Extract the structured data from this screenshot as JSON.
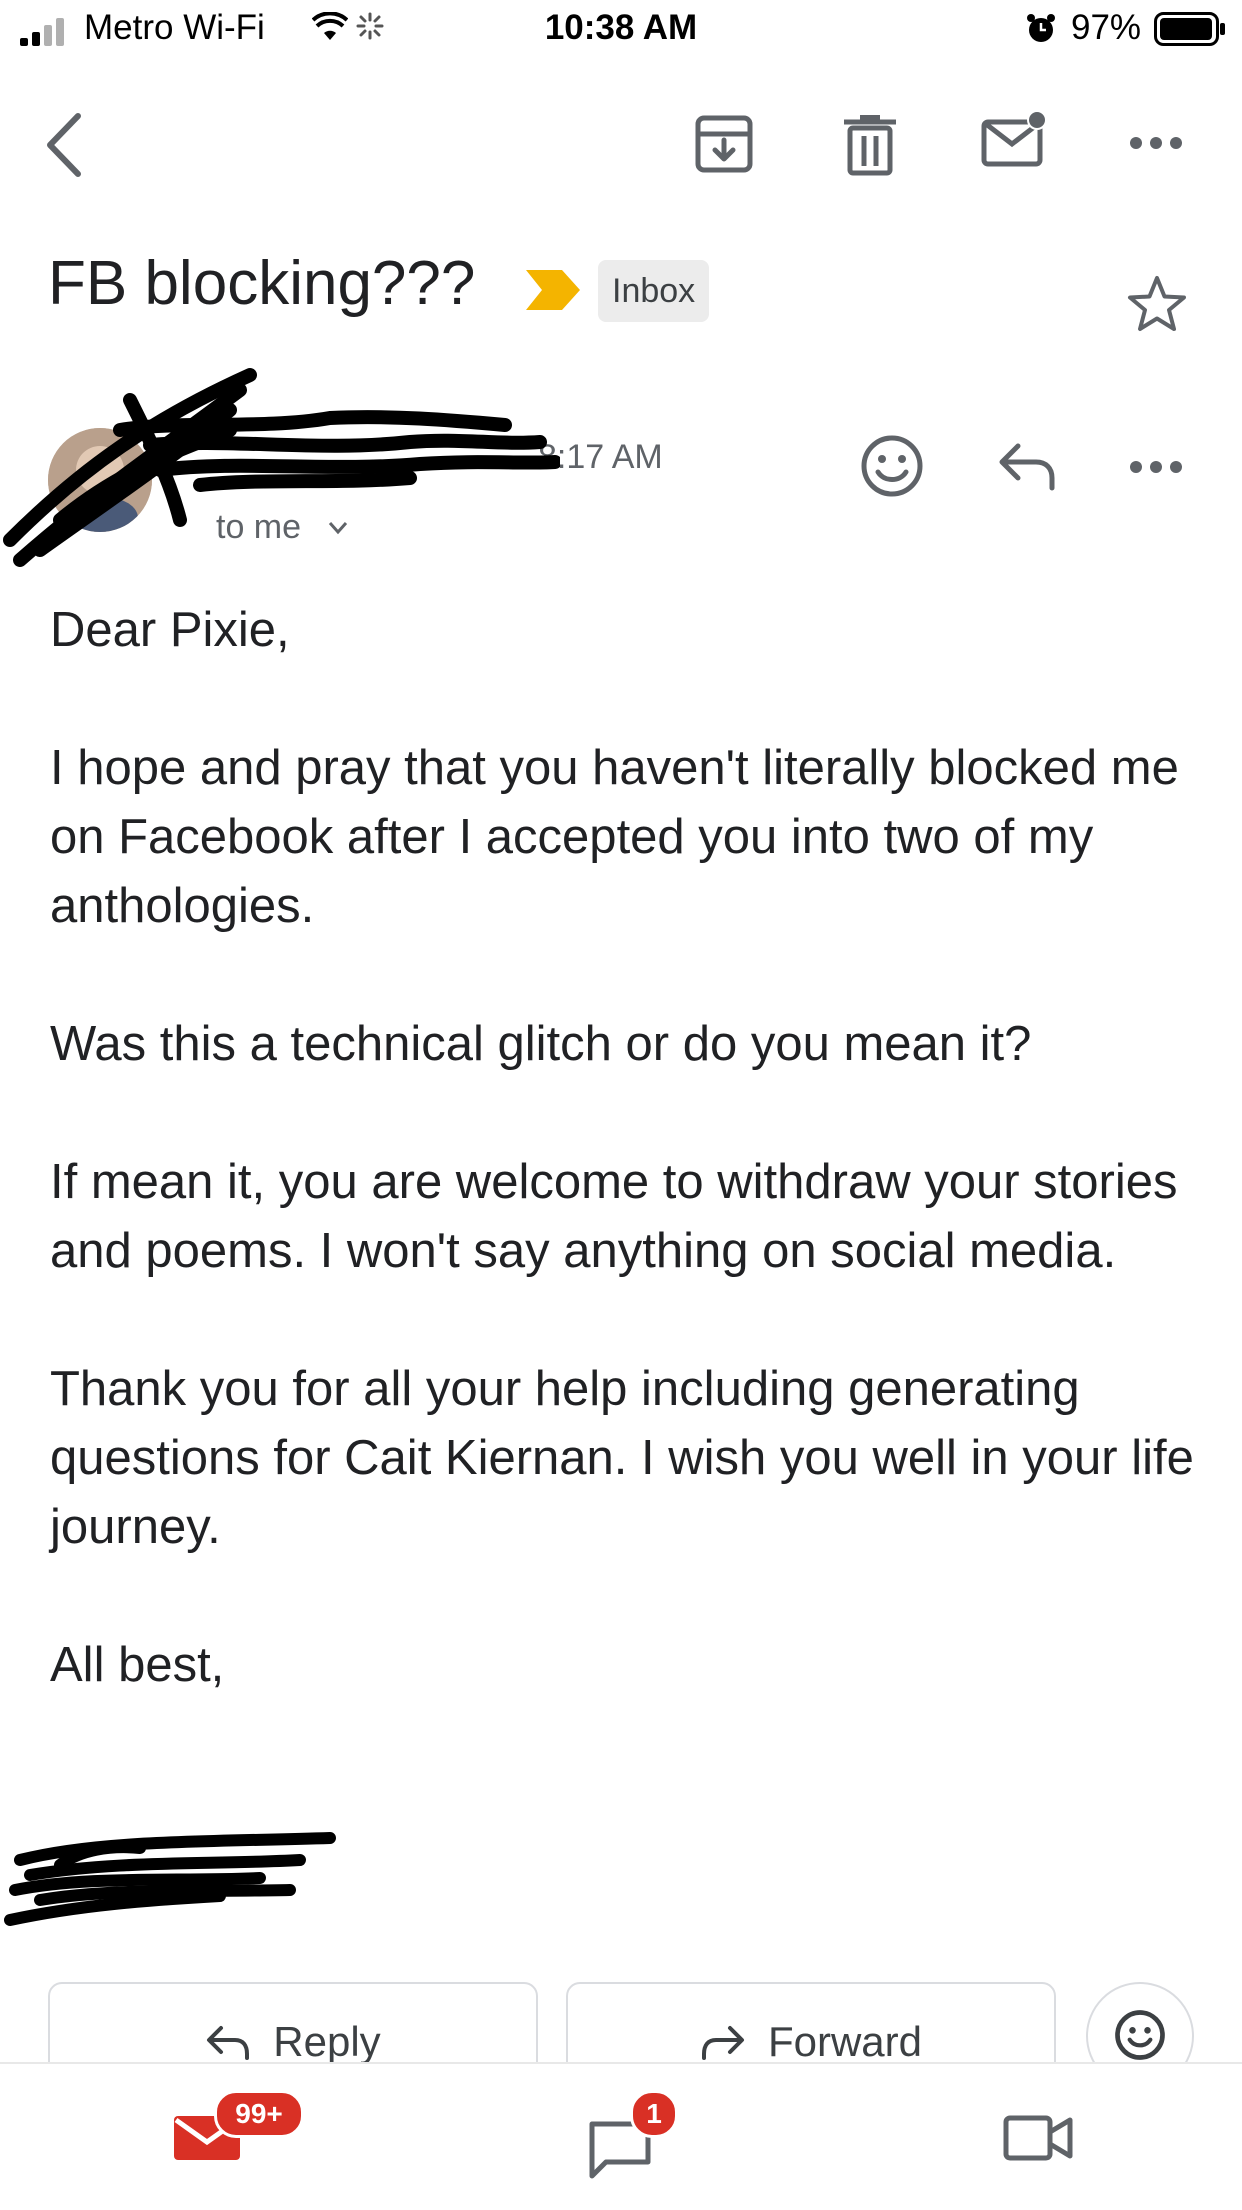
{
  "status_bar": {
    "carrier": "Metro Wi-Fi",
    "time": "10:38 AM",
    "battery": "97%"
  },
  "toolbar": {
    "icons": [
      "back-icon",
      "archive-icon",
      "trash-icon",
      "mark-unread-icon",
      "more-icon"
    ]
  },
  "subject": {
    "title": "FB blocking???",
    "label": "Inbox",
    "importance_color": "#f4b400"
  },
  "sender": {
    "time": "8:17 AM",
    "recipient": "to me"
  },
  "body": {
    "paragraphs": [
      "Dear Pixie,",
      "I hope and pray that you haven't literally blocked me on Facebook after I accepted you into two of my anthologies.",
      "Was this a technical glitch or do you mean it?",
      "If mean it, you are welcome to withdraw your stories and poems. I won't say anything on social media.",
      "Thank you for all your help including generating questions for Cait Kiernan. I wish you well in your life journey.",
      "All best,"
    ]
  },
  "actions": {
    "reply": "Reply",
    "forward": "Forward"
  },
  "bottom_nav": {
    "mail_badge": "99+",
    "chat_badge": "1",
    "accent_color": "#d93025"
  }
}
